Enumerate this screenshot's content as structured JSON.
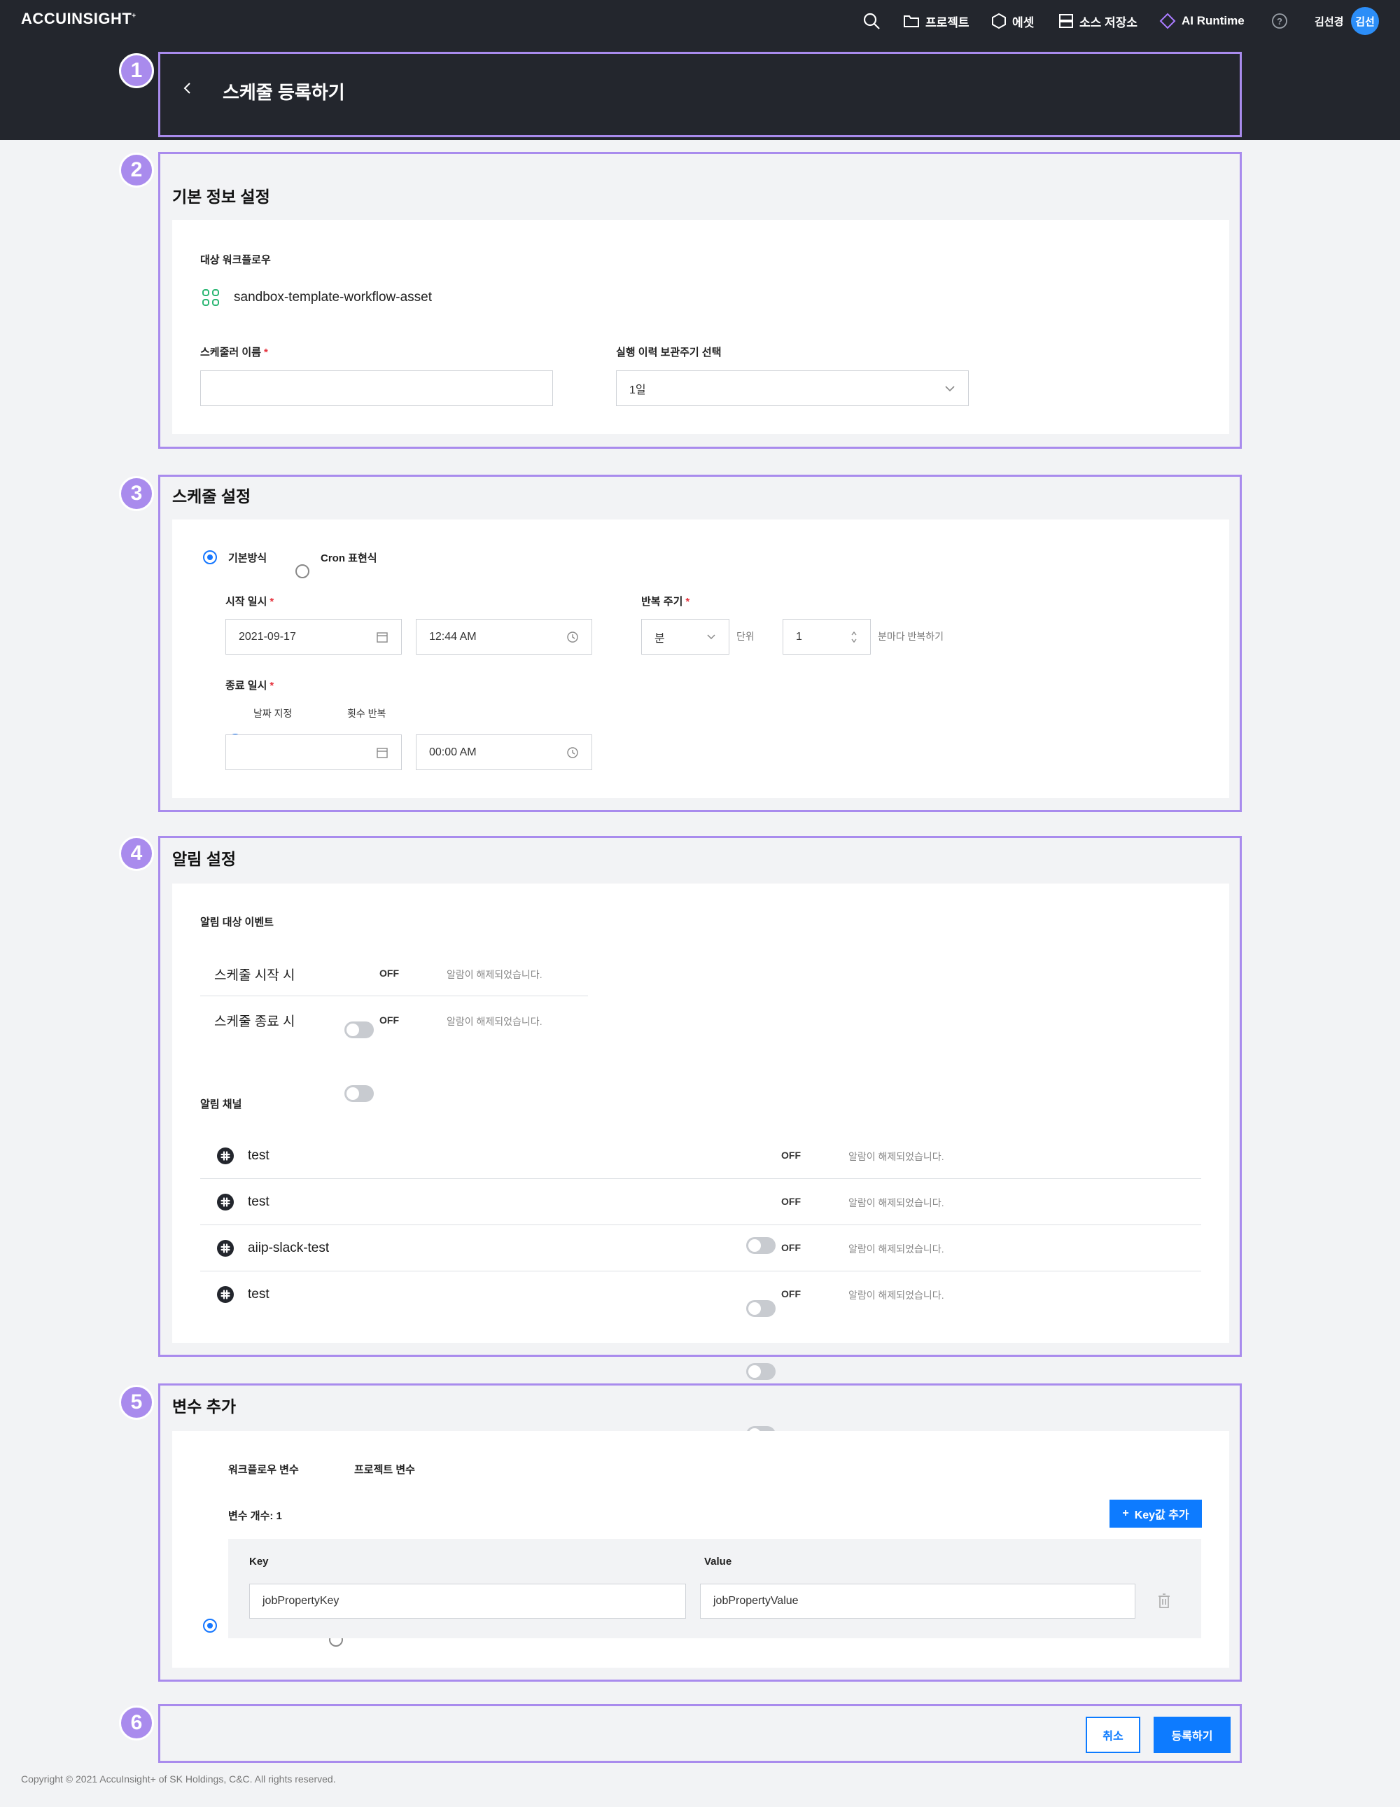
{
  "header": {
    "logo": "ACCUINSIGHT",
    "nav": [
      {
        "label": "프로젝트",
        "icon": "folder-icon"
      },
      {
        "label": "에셋",
        "icon": "hexagon-icon"
      },
      {
        "label": "소스 저장소",
        "icon": "storage-icon"
      },
      {
        "label": "AI Runtime",
        "icon": "diamond-icon"
      }
    ],
    "user_name": "김선경",
    "avatar_text": "김선"
  },
  "markers": [
    "1",
    "2",
    "3",
    "4",
    "5",
    "6"
  ],
  "page": {
    "title": "스케줄 등록하기"
  },
  "basic": {
    "title": "기본 정보 설정",
    "workflow_label": "대상 워크플로우",
    "workflow_name": "sandbox-template-workflow-asset",
    "scheduler_name_label": "스케줄러 이름",
    "scheduler_name_value": "",
    "retention_label": "실행 이력 보관주기 선택",
    "retention_value": "1일"
  },
  "schedule": {
    "title": "스케줄 설정",
    "mode_basic": "기본방식",
    "mode_cron": "Cron 표현식",
    "start_label": "시작 일시",
    "start_date": "2021-09-17",
    "start_time": "12:44 AM",
    "repeat_label": "반복 주기",
    "repeat_unit": "분",
    "unit_text": "단위",
    "repeat_value": "1",
    "repeat_suffix": "분마다 반복하기",
    "end_label": "종료 일시",
    "end_opt_date": "날짜 지정",
    "end_opt_count": "횟수 반복",
    "end_date": "",
    "end_time": "00:00 AM"
  },
  "alerts": {
    "title": "알림 설정",
    "events_label": "알림 대상 이벤트",
    "events": [
      {
        "name": "스케줄 시작 시",
        "state": "OFF",
        "status": "알람이 해제되었습니다."
      },
      {
        "name": "스케줄 종료 시",
        "state": "OFF",
        "status": "알람이 해제되었습니다."
      }
    ],
    "channels_label": "알림 채널",
    "channels": [
      {
        "name": "test",
        "state": "OFF",
        "status": "알람이 해제되었습니다."
      },
      {
        "name": "test",
        "state": "OFF",
        "status": "알람이 해제되었습니다."
      },
      {
        "name": "aiip-slack-test",
        "state": "OFF",
        "status": "알람이 해제되었습니다."
      },
      {
        "name": "test",
        "state": "OFF",
        "status": "알람이 해제되었습니다."
      }
    ]
  },
  "variables": {
    "title": "변수 추가",
    "opt_workflow": "워크플로우 변수",
    "opt_project": "프로젝트 변수",
    "count_label": "변수 개수: 1",
    "add_button": "Key값 추가",
    "key_header": "Key",
    "value_header": "Value",
    "rows": [
      {
        "key": "jobPropertyKey",
        "value": "jobPropertyValue"
      }
    ]
  },
  "footer_actions": {
    "cancel": "취소",
    "submit": "등록하기"
  },
  "copyright": "Copyright © 2021 AccuInsight+ of SK Holdings, C&C. All rights reserved.",
  "colors": {
    "accent": "#0d7bff",
    "marker": "#a98bed",
    "header_bg": "#23262d"
  }
}
